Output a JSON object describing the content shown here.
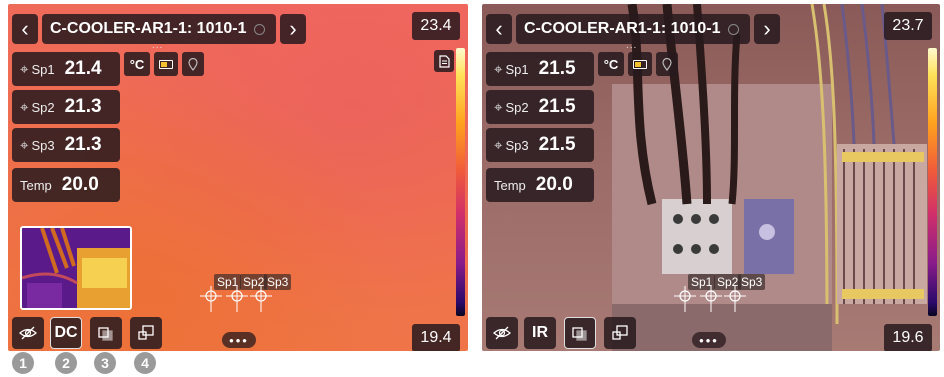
{
  "left_screen": {
    "title": "C-COOLER-AR1-1: 1010-1",
    "title_dots": "...",
    "nav_prev": "‹",
    "nav_next": "›",
    "measurements": [
      {
        "label": "Sp1",
        "value": "21.4"
      },
      {
        "label": "Sp2",
        "value": "21.3"
      },
      {
        "label": "Sp3",
        "value": "21.3"
      },
      {
        "label": "Temp",
        "value": "20.0"
      }
    ],
    "unit": "°C",
    "scale_max": "23.4",
    "scale_min": "19.4",
    "spots": [
      "Sp1",
      "Sp2",
      "Sp3"
    ],
    "bottom_buttons": {
      "dc": "DC"
    },
    "more_dots": "•••"
  },
  "right_screen": {
    "title": "C-COOLER-AR1-1: 1010-1",
    "title_dots": "...",
    "nav_prev": "‹",
    "nav_next": "›",
    "measurements": [
      {
        "label": "Sp1",
        "value": "21.5"
      },
      {
        "label": "Sp2",
        "value": "21.5"
      },
      {
        "label": "Sp3",
        "value": "21.5"
      },
      {
        "label": "Temp",
        "value": "20.0"
      }
    ],
    "unit": "°C",
    "scale_max": "23.7",
    "scale_min": "19.6",
    "spots": [
      "Sp1",
      "Sp2",
      "Sp3"
    ],
    "bottom_buttons": {
      "ir": "IR"
    },
    "more_dots": "•••"
  },
  "callouts": [
    "1",
    "2",
    "3",
    "4"
  ],
  "colors": {
    "panel": "#281a1e",
    "palette_top": "#fffbd0",
    "palette_bottom": "#0a0620",
    "callout": "#9a9a9a"
  },
  "icons": {
    "measure": "crosshair-icon",
    "battery": "battery-icon",
    "location": "location-pin-icon",
    "document": "document-icon",
    "hide": "eye-slash-icon",
    "picture_in_picture": "overlap-squares-icon",
    "fusion": "fusion-squares-icon"
  }
}
